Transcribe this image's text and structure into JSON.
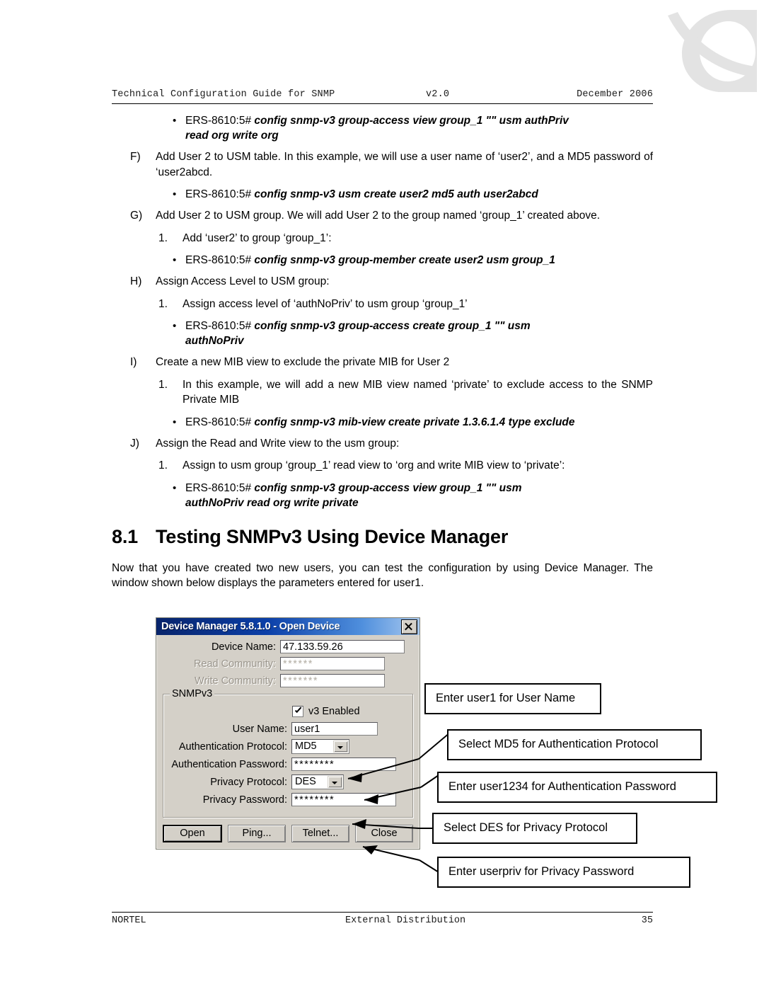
{
  "header": {
    "left": "Technical Configuration Guide for SNMP",
    "middle": "v2.0",
    "right": "December 2006"
  },
  "logo": {
    "name": "nortel-globemark-logo",
    "color": "#e2e2e2"
  },
  "body": {
    "cmd_top": {
      "bullet": "•",
      "prompt": "ERS-8610:5#",
      "code_line1": "config snmp-v3 group-access view group_1 \"\" usm authPriv",
      "code_line2": "read org write org"
    },
    "item_f": {
      "label": "F)",
      "text": "Add User 2 to USM table. In this example, we will use a user name of ‘user2’, and a MD5 password of ‘user2abcd."
    },
    "cmd_f": {
      "bullet": "•",
      "prompt": "ERS-8610:5#",
      "code": "config snmp-v3 usm create user2 md5 auth user2abcd"
    },
    "item_g": {
      "label": "G)",
      "text": "Add User 2 to USM group. We will add User 2 to the group named ‘group_1’ created above."
    },
    "sub_g1": {
      "label": "1.",
      "text": "Add ‘user2’ to group ‘group_1’:"
    },
    "cmd_g": {
      "bullet": "•",
      "prompt": "ERS-8610:5#",
      "code": "config snmp-v3 group-member create user2 usm group_1"
    },
    "item_h": {
      "label": "H)",
      "text": "Assign Access Level to USM group:"
    },
    "sub_h1": {
      "label": "1.",
      "text": "Assign access level of ‘authNoPriv’ to usm group ‘group_1’"
    },
    "cmd_h": {
      "bullet": "•",
      "prompt": "ERS-8610:5#",
      "code_line1": "config   snmp-v3   group-access   create   group_1   \"\"   usm",
      "code_line2": "authNoPriv"
    },
    "item_i": {
      "label": "I)",
      "text": "Create a new MIB view to exclude the private MIB for User 2"
    },
    "sub_i1": {
      "label": "1.",
      "text": "In this example, we will add a new MIB view named ‘private’ to exclude access to the SNMP Private MIB"
    },
    "cmd_i": {
      "bullet": "•",
      "prompt": "ERS-8610:5#",
      "code": "config snmp-v3 mib-view create private 1.3.6.1.4 type exclude"
    },
    "item_j": {
      "label": "J)",
      "text": "Assign the Read and Write view to the usm group:"
    },
    "sub_j1": {
      "label": "1.",
      "text": "Assign to usm group ‘group_1’ read view to ‘org and write MIB view to ‘private’:"
    },
    "cmd_j": {
      "bullet": "•",
      "prompt": "ERS-8610:5#",
      "code_line1": "config   snmp-v3   group-access   view   group_1   \"\"   usm",
      "code_line2": "authNoPriv read org write private"
    },
    "heading": {
      "number": "8.1",
      "title": "Testing SNMPv3 Using Device Manager"
    },
    "intro": "Now that you have created two new users, you can test the configuration by using Device Manager. The window shown below displays the parameters entered for user1."
  },
  "dialog": {
    "title": "Device Manager 5.8.1.0 - Open Device",
    "close_icon": "close-icon",
    "fields": {
      "device_name_label": "Device Name:",
      "device_name_value": "47.133.59.26",
      "read_community_label": "Read Community:",
      "read_community_value": "******",
      "write_community_label": "Write Community:",
      "write_community_value": "*******"
    },
    "group": {
      "title": "SNMPv3",
      "v3_enabled_label": "v3 Enabled",
      "v3_enabled_checked": true,
      "user_name_label": "User Name:",
      "user_name_value": "user1",
      "auth_protocol_label": "Authentication Protocol:",
      "auth_protocol_value": "MD5",
      "auth_password_label": "Authentication Password:",
      "auth_password_value": "********",
      "privacy_protocol_label": "Privacy Protocol:",
      "privacy_protocol_value": "DES",
      "privacy_password_label": "Privacy Password:",
      "privacy_password_value": "********"
    },
    "buttons": {
      "open": "Open",
      "ping": "Ping...",
      "telnet": "Telnet...",
      "close": "Close"
    }
  },
  "callouts": {
    "user_name": "Enter user1 for User Name",
    "auth_protocol": "Select MD5 for Authentication Protocol",
    "auth_password": "Enter user1234 for Authentication Password",
    "privacy_protocol": "Select DES for Privacy Protocol",
    "privacy_password": "Enter userpriv for Privacy Password"
  },
  "footer": {
    "left": "NORTEL",
    "middle": "External Distribution",
    "right": "35"
  }
}
